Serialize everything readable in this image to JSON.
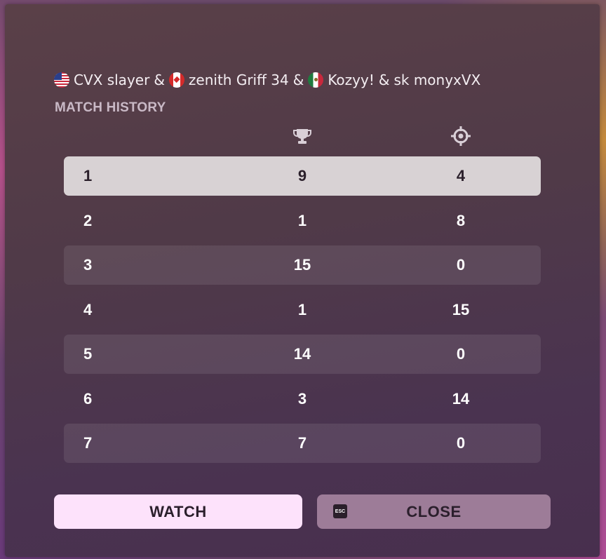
{
  "header": {
    "players": [
      {
        "flag": "us-flag",
        "name": "CVX slayer"
      },
      {
        "flag": "ca-flag",
        "name": "zenith Griff 34"
      },
      {
        "flag": "mx-flag",
        "name": "Kozyy!"
      }
    ],
    "last_player": "sk monyxVX",
    "separator": "&",
    "subtitle": "MATCH HISTORY"
  },
  "columns": {
    "wins_icon": "trophy-icon",
    "elims_icon": "crosshair-icon"
  },
  "rows": [
    {
      "rank": "1",
      "wins": "9",
      "elims": "4"
    },
    {
      "rank": "2",
      "wins": "1",
      "elims": "8"
    },
    {
      "rank": "3",
      "wins": "15",
      "elims": "0"
    },
    {
      "rank": "4",
      "wins": "1",
      "elims": "15"
    },
    {
      "rank": "5",
      "wins": "14",
      "elims": "0"
    },
    {
      "rank": "6",
      "wins": "3",
      "elims": "14"
    },
    {
      "rank": "7",
      "wins": "7",
      "elims": "0"
    }
  ],
  "selected_row": 1,
  "buttons": {
    "watch_label": "WATCH",
    "close_label": "CLOSE",
    "close_key": "ESC"
  },
  "colors": {
    "watch_bg": "#fde2fb",
    "close_bg": "#9d7c98",
    "selected_row_bg": "#d8d2d4"
  }
}
